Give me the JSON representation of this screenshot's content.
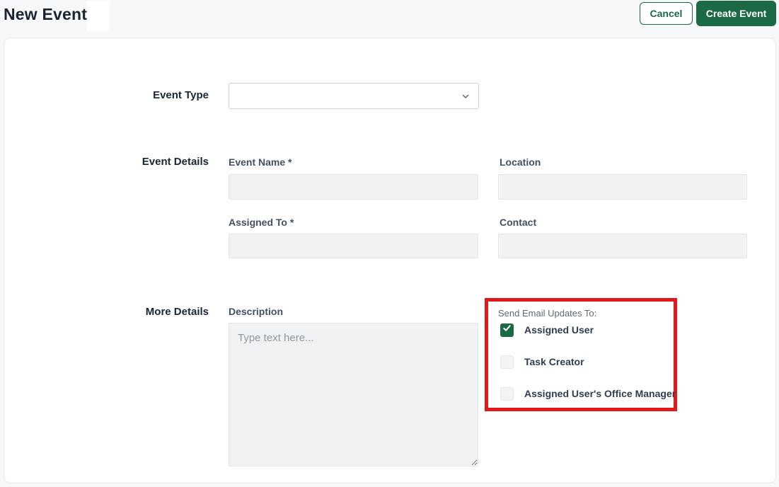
{
  "header": {
    "title": "New Event",
    "cancel_label": "Cancel",
    "create_label": "Create Event"
  },
  "colors": {
    "brand_green": "#1c6a45",
    "highlight_red": "#e01a1a",
    "input_fill": "#f1f2f4",
    "page_background": "#f7f8fa"
  },
  "form": {
    "event_type": {
      "section_label": "Event Type",
      "selected_value": ""
    },
    "event_details": {
      "section_label": "Event Details",
      "fields": {
        "event_name": {
          "label": "Event Name *",
          "value": ""
        },
        "location": {
          "label": "Location",
          "value": ""
        },
        "assigned_to": {
          "label": "Assigned To *",
          "value": ""
        },
        "contact": {
          "label": "Contact",
          "value": ""
        }
      }
    },
    "more_details": {
      "section_label": "More Details",
      "description": {
        "label": "Description",
        "placeholder": "Type text here...",
        "value": ""
      },
      "email_updates": {
        "label": "Send Email Updates To:",
        "options": [
          {
            "label": "Assigned User",
            "checked": true
          },
          {
            "label": "Task Creator",
            "checked": false
          },
          {
            "label": "Assigned User's Office Manager",
            "checked": false
          }
        ]
      }
    }
  }
}
